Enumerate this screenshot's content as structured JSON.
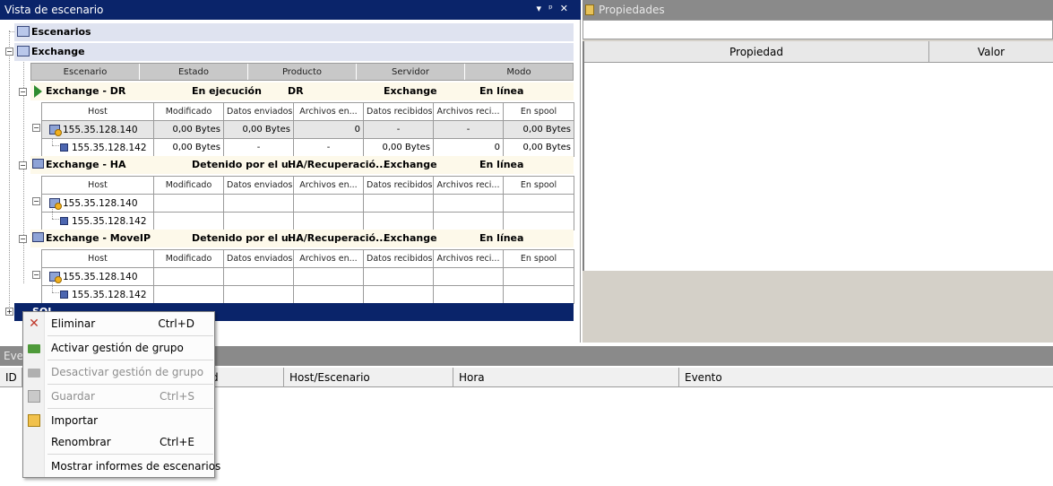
{
  "scenario_view": {
    "title": "Vista de escenario",
    "controls": [
      "▾",
      "ᵖ",
      "✕"
    ],
    "root_group": "Escenarios",
    "group": "Exchange",
    "columns": [
      "Escenario",
      "Estado",
      "Producto",
      "Servidor",
      "Modo"
    ],
    "host_columns": [
      "Host",
      "Modificado",
      "Datos enviados",
      "Archivos en...",
      "Datos recibidos",
      "Archivos reci...",
      "En spool"
    ],
    "scenarios": [
      {
        "name": "Exchange - DR",
        "state": "En ejecución",
        "product": "DR",
        "server": "Exchange",
        "mode": "En línea",
        "hosts": [
          {
            "host": "155.35.128.140",
            "modified": "0,00 Bytes",
            "sent": "0,00 Bytes",
            "files_sent": "0",
            "received": "-",
            "files_received": "-",
            "spool": "0,00 Bytes"
          },
          {
            "host": "155.35.128.142",
            "modified": "0,00 Bytes",
            "sent": "-",
            "files_sent": "-",
            "received": "0,00 Bytes",
            "files_received": "0",
            "spool": "0,00 Bytes"
          }
        ]
      },
      {
        "name": "Exchange - HA",
        "state": "Detenido por el u...",
        "product": "HA/Recuperació...",
        "server": "Exchange",
        "mode": "En línea",
        "hosts": [
          {
            "host": "155.35.128.140"
          },
          {
            "host": "155.35.128.142"
          }
        ]
      },
      {
        "name": "Exchange - MoveIP",
        "state": "Detenido por el u...",
        "product": "HA/Recuperació...",
        "server": "Exchange",
        "mode": "En línea",
        "hosts": [
          {
            "host": "155.35.128.140"
          },
          {
            "host": "155.35.128.142"
          }
        ]
      }
    ],
    "selected_group_partial": "SQL"
  },
  "properties": {
    "title": "Propiedades",
    "columns": [
      "Propiedad",
      "Valor"
    ]
  },
  "events": {
    "title": "Even",
    "columns": [
      "ID",
      "d",
      "Host/Escenario",
      "Hora",
      "Evento"
    ]
  },
  "context_menu": {
    "items": [
      {
        "label": "Eliminar",
        "shortcut": "Ctrl+D",
        "icon": "delete-icon",
        "enabled": true
      },
      {
        "label": "Activar gestión de grupo",
        "shortcut": "",
        "icon": "folder-icon",
        "enabled": true
      },
      {
        "label": "Desactivar gestión de grupo",
        "shortcut": "",
        "icon": "folder-icon",
        "enabled": false
      },
      {
        "label": "Guardar",
        "shortcut": "Ctrl+S",
        "icon": "save-icon",
        "enabled": false
      },
      {
        "label": "Importar",
        "shortcut": "",
        "icon": "import-icon",
        "enabled": true
      },
      {
        "label": "Renombrar",
        "shortcut": "Ctrl+E",
        "icon": "",
        "enabled": true
      },
      {
        "label": "Mostrar informes de escenarios",
        "shortcut": "",
        "icon": "",
        "enabled": true
      }
    ]
  },
  "colors": {
    "title_active": "#0a246a",
    "title_inactive": "#8a8a8a",
    "group_row": "#dfe3f0",
    "scenario_row": "#fdf9ea",
    "running": "#2e8c2e"
  }
}
